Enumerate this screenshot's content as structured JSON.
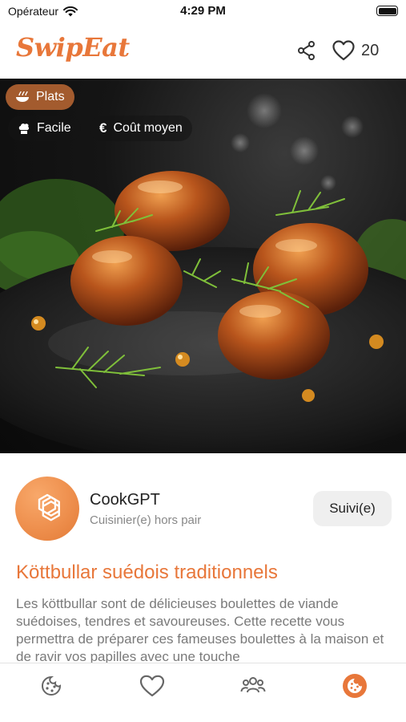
{
  "status_bar": {
    "carrier": "Opérateur",
    "time": "4:29 PM"
  },
  "header": {
    "logo": "SwipEat",
    "like_count": "20"
  },
  "hero": {
    "category": "Plats",
    "difficulty": "Facile",
    "cost": "Coût moyen",
    "cost_symbol": "€"
  },
  "author": {
    "name": "CookGPT",
    "role": "Cuisinier(e) hors pair",
    "follow_label": "Suivi(e)"
  },
  "recipe": {
    "title": "Köttbullar suédois traditionnels",
    "description": "Les köttbullar sont de délicieuses boulettes de viande suédoises, tendres et savoureuses. Cette recette vous permettra de préparer ces fameuses boulettes à la maison et de ravir vos papilles avec une touche"
  },
  "colors": {
    "accent": "#e8773a",
    "chip": "#a35b2e",
    "muted": "#888888"
  },
  "tab_bar": {
    "items": [
      "cookie-icon",
      "heart-icon",
      "people-icon",
      "cookie-active-icon"
    ]
  }
}
